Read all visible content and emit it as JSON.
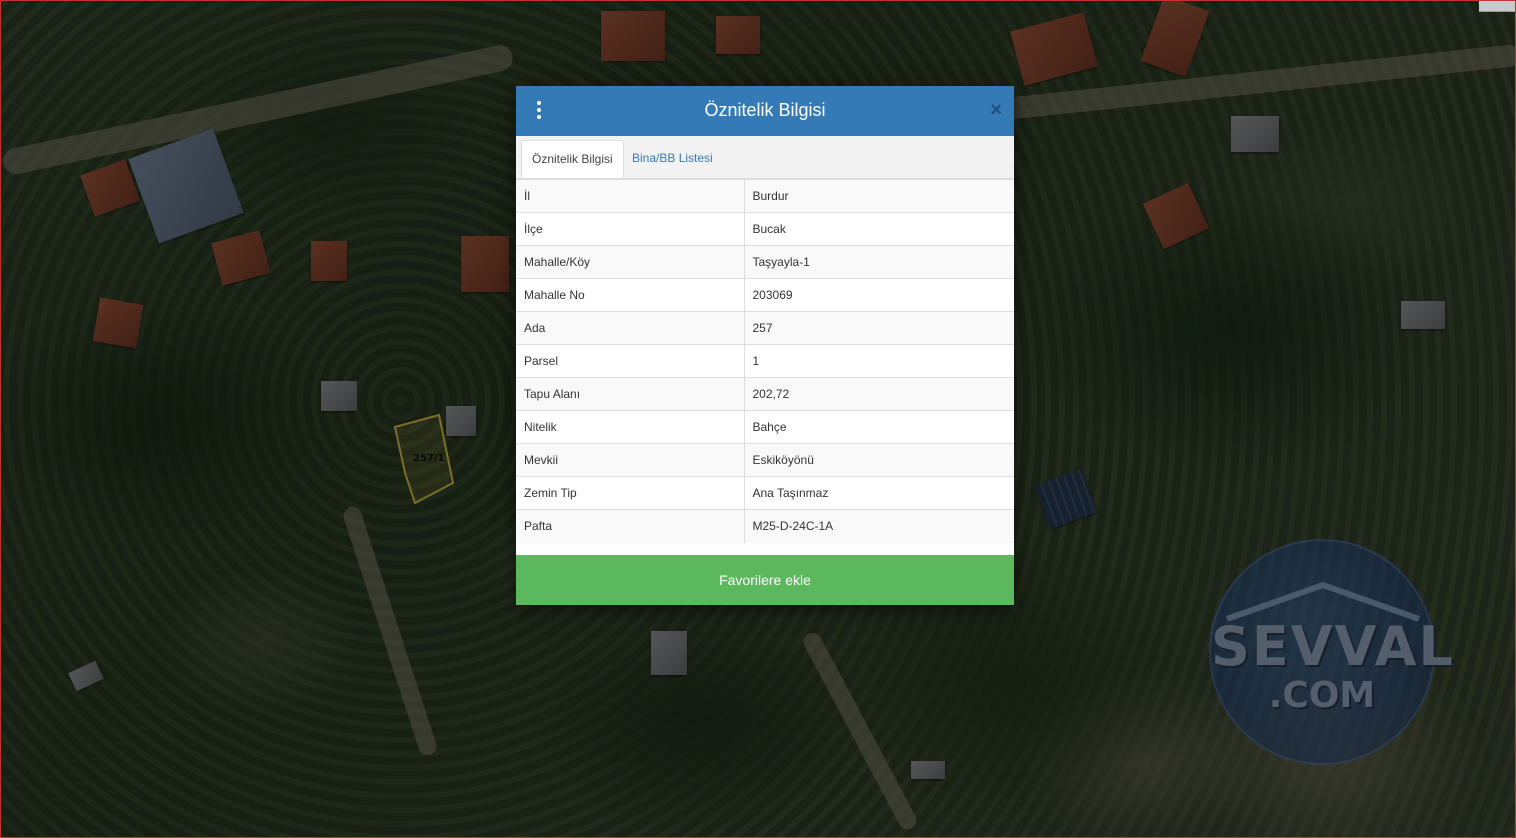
{
  "map": {
    "parcel_label": "257/1"
  },
  "watermark": {
    "line1": "SEVVAL",
    "line2": ".COM"
  },
  "modal": {
    "title": "Öznitelik Bilgisi",
    "close_glyph": "×",
    "tabs": [
      {
        "label": "Öznitelik Bilgisi",
        "active": true
      },
      {
        "label": "Bina/BB Listesi",
        "active": false
      }
    ],
    "rows": [
      {
        "key": "İl",
        "value": "Burdur"
      },
      {
        "key": "İlçe",
        "value": "Bucak"
      },
      {
        "key": "Mahalle/Köy",
        "value": "Taşyayla-1"
      },
      {
        "key": "Mahalle No",
        "value": "203069"
      },
      {
        "key": "Ada",
        "value": "257"
      },
      {
        "key": "Parsel",
        "value": "1"
      },
      {
        "key": "Tapu Alanı",
        "value": "202,72"
      },
      {
        "key": "Nitelik",
        "value": "Bahçe"
      },
      {
        "key": "Mevkii",
        "value": "Eskiköyönü"
      },
      {
        "key": "Zemin Tip",
        "value": "Ana Taşınmaz"
      },
      {
        "key": "Pafta",
        "value": "M25-D-24C-1A"
      }
    ],
    "favorite_button": "Favorilere ekle"
  },
  "colors": {
    "header": "#337ab7",
    "button": "#5cb85c",
    "tab_link": "#337ab7"
  },
  "icons": {
    "menu": "kebab-menu-icon",
    "close": "close-icon"
  }
}
